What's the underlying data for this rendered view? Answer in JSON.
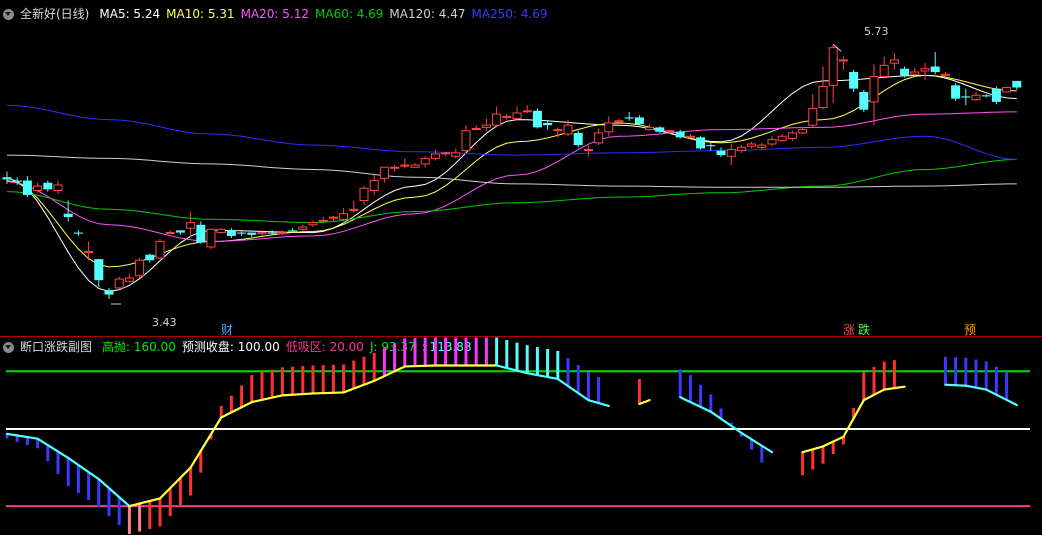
{
  "colors": {
    "up": "#ff4444",
    "down": "#54ffff",
    "ma5": "#ffffff",
    "ma10": "#ffff54",
    "ma20": "#ff54ff",
    "ma60": "#00cc00",
    "ma120": "#d0d0d0",
    "ma250": "#2d2dff",
    "separator": "#aa0000",
    "high_line": "#00dd00",
    "mid_line": "#ffffff",
    "low_line": "#ff3399"
  },
  "main": {
    "title": "全新好(日线)",
    "ma": [
      {
        "label": "MA5: 5.24",
        "color": "#ffffff"
      },
      {
        "label": "MA10: 5.31",
        "color": "#ffff54"
      },
      {
        "label": "MA20: 5.12",
        "color": "#ff54ff"
      },
      {
        "label": "MA60: 4.69",
        "color": "#00cc00"
      },
      {
        "label": "MA120: 4.47",
        "color": "#d0d0d0"
      },
      {
        "label": "MA250: 4.69",
        "color": "#3a3aff"
      }
    ],
    "high_label": "5.73",
    "low_label": "3.43",
    "markers": {
      "cai": "财",
      "zhang": "涨",
      "die": "跌",
      "yu": "预"
    }
  },
  "sub": {
    "title": "断口涨跌副图",
    "items": [
      {
        "label": "高抛: 160.00",
        "color": "#00ee00"
      },
      {
        "label": "预测收盘: 100.00",
        "color": "#ffffff"
      },
      {
        "label": "低吸区: 20.00",
        "color": "#ff3399"
      },
      {
        "label": "J: 93.37",
        "color": "#00ee00"
      },
      {
        "label": ": 113.88",
        "color": "#54ffff"
      }
    ]
  },
  "chart_data": [
    {
      "type": "candlestick",
      "title": "全新好(日线)",
      "ylim": [
        3.15,
        5.95
      ],
      "highest": 5.73,
      "lowest": 3.43,
      "candles": [
        [
          4.53,
          4.51,
          4.58,
          4.47
        ],
        [
          4.5,
          4.49,
          4.53,
          4.46
        ],
        [
          4.5,
          4.37,
          4.54,
          4.35
        ],
        [
          4.41,
          4.45,
          4.48,
          4.39
        ],
        [
          4.48,
          4.42,
          4.5,
          4.4
        ],
        [
          4.41,
          4.46,
          4.5,
          4.38
        ],
        [
          4.2,
          4.17,
          4.32,
          4.13
        ],
        [
          4.03,
          4.02,
          4.05,
          4.0
        ],
        [
          3.85,
          3.86,
          3.95,
          3.78
        ],
        [
          3.79,
          3.6,
          3.79,
          3.54
        ],
        [
          3.51,
          3.47,
          3.53,
          3.43
        ],
        [
          3.53,
          3.61,
          3.63,
          3.52
        ],
        [
          3.59,
          3.62,
          3.66,
          3.58
        ],
        [
          3.64,
          3.78,
          3.8,
          3.62
        ],
        [
          3.83,
          3.78,
          3.84,
          3.76
        ],
        [
          3.8,
          3.95,
          3.97,
          3.79
        ],
        [
          4.03,
          4.03,
          4.05,
          4.02
        ],
        [
          4.05,
          4.03,
          4.05,
          4.01
        ],
        [
          4.07,
          4.12,
          4.22,
          3.99
        ],
        [
          4.1,
          3.94,
          4.13,
          3.93
        ],
        [
          3.9,
          4.06,
          4.06,
          3.88
        ],
        [
          4.03,
          4.06,
          4.07,
          4.02
        ],
        [
          4.05,
          4.0,
          4.07,
          3.98
        ],
        [
          4.03,
          4.02,
          4.04,
          4.0
        ],
        [
          4.03,
          4.01,
          4.03,
          3.99
        ],
        [
          4.02,
          4.03,
          4.05,
          4.0
        ],
        [
          4.03,
          4.02,
          4.05,
          4.01
        ],
        [
          4.02,
          4.03,
          4.05,
          4.01
        ],
        [
          4.05,
          4.04,
          4.07,
          4.03
        ],
        [
          4.06,
          4.08,
          4.1,
          4.04
        ],
        [
          4.1,
          4.12,
          4.14,
          4.08
        ],
        [
          4.14,
          4.14,
          4.17,
          4.12
        ],
        [
          4.16,
          4.17,
          4.18,
          4.13
        ],
        [
          4.15,
          4.2,
          4.25,
          4.13
        ],
        [
          4.24,
          4.24,
          4.32,
          4.21
        ],
        [
          4.32,
          4.43,
          4.45,
          4.28
        ],
        [
          4.41,
          4.5,
          4.55,
          4.37
        ],
        [
          4.52,
          4.62,
          4.62,
          4.48
        ],
        [
          4.62,
          4.62,
          4.64,
          4.58
        ],
        [
          4.63,
          4.64,
          4.7,
          4.61
        ],
        [
          4.62,
          4.64,
          4.66,
          4.62
        ],
        [
          4.65,
          4.7,
          4.72,
          4.62
        ],
        [
          4.7,
          4.74,
          4.78,
          4.68
        ],
        [
          4.75,
          4.75,
          4.76,
          4.72
        ],
        [
          4.72,
          4.75,
          4.79,
          4.7
        ],
        [
          4.77,
          4.95,
          5.0,
          4.76
        ],
        [
          4.97,
          4.97,
          5.0,
          4.95
        ],
        [
          4.98,
          5.0,
          5.06,
          4.95
        ],
        [
          5.0,
          5.1,
          5.17,
          4.98
        ],
        [
          5.07,
          5.08,
          5.1,
          5.05
        ],
        [
          5.06,
          5.11,
          5.17,
          5.04
        ],
        [
          5.13,
          5.13,
          5.18,
          5.11
        ],
        [
          5.13,
          4.98,
          5.15,
          4.97
        ],
        [
          5.02,
          5.0,
          5.04,
          4.96
        ],
        [
          4.96,
          4.96,
          4.98,
          4.89
        ],
        [
          4.92,
          5.0,
          5.05,
          4.9
        ],
        [
          4.93,
          4.82,
          4.95,
          4.8
        ],
        [
          4.78,
          4.78,
          4.82,
          4.72
        ],
        [
          4.84,
          4.93,
          4.97,
          4.82
        ],
        [
          4.94,
          5.02,
          5.08,
          4.9
        ],
        [
          5.03,
          5.04,
          5.06,
          5.01
        ],
        [
          5.07,
          5.06,
          5.12,
          5.04
        ],
        [
          5.07,
          5.01,
          5.09,
          5.0
        ],
        [
          4.96,
          4.98,
          5.01,
          4.95
        ],
        [
          4.98,
          4.94,
          4.99,
          4.93
        ],
        [
          4.95,
          4.95,
          4.96,
          4.92
        ],
        [
          4.94,
          4.89,
          4.96,
          4.88
        ],
        [
          4.89,
          4.9,
          4.92,
          4.88
        ],
        [
          4.89,
          4.79,
          4.9,
          4.78
        ],
        [
          4.82,
          4.81,
          4.84,
          4.77
        ],
        [
          4.77,
          4.73,
          4.8,
          4.71
        ],
        [
          4.72,
          4.78,
          4.83,
          4.64
        ],
        [
          4.77,
          4.8,
          4.82,
          4.75
        ],
        [
          4.81,
          4.83,
          4.85,
          4.79
        ],
        [
          4.8,
          4.82,
          4.84,
          4.78
        ],
        [
          4.83,
          4.87,
          4.9,
          4.81
        ],
        [
          4.86,
          4.9,
          4.92,
          4.85
        ],
        [
          4.88,
          4.93,
          4.95,
          4.86
        ],
        [
          4.93,
          4.96,
          4.98,
          4.92
        ],
        [
          5.0,
          5.15,
          5.28,
          4.98
        ],
        [
          5.16,
          5.35,
          5.53,
          5.14
        ],
        [
          5.36,
          5.7,
          5.73,
          5.2
        ],
        [
          5.58,
          5.59,
          5.62,
          5.5
        ],
        [
          5.48,
          5.33,
          5.5,
          5.3
        ],
        [
          5.3,
          5.14,
          5.32,
          5.12
        ],
        [
          5.21,
          5.44,
          5.55,
          5.0
        ],
        [
          5.44,
          5.54,
          5.62,
          5.42
        ],
        [
          5.56,
          5.59,
          5.65,
          5.5
        ],
        [
          5.51,
          5.45,
          5.53,
          5.43
        ],
        [
          5.46,
          5.48,
          5.52,
          5.44
        ],
        [
          5.49,
          5.51,
          5.56,
          5.41
        ],
        [
          5.53,
          5.48,
          5.66,
          5.46
        ],
        [
          5.45,
          5.46,
          5.48,
          5.43
        ],
        [
          5.36,
          5.24,
          5.38,
          5.22
        ],
        [
          5.26,
          5.25,
          5.33,
          5.18
        ],
        [
          5.23,
          5.27,
          5.3,
          5.22
        ],
        [
          5.27,
          5.26,
          5.28,
          5.25
        ],
        [
          5.33,
          5.21,
          5.35,
          5.19
        ],
        [
          5.3,
          5.34,
          5.35,
          5.3
        ],
        [
          5.4,
          5.34,
          5.4,
          5.32
        ]
      ],
      "series": [
        {
          "name": "MA5",
          "color": "#ffffff",
          "x": [
            0,
            10,
            20,
            30,
            40,
            50,
            60,
            70,
            80,
            90,
            99
          ],
          "y": [
            4.52,
            3.5,
            4.05,
            4.03,
            4.45,
            5.05,
            5.0,
            4.85,
            5.4,
            5.45,
            5.24
          ]
        },
        {
          "name": "MA10",
          "color": "#ffff54",
          "x": [
            0,
            10,
            20,
            30,
            40,
            50,
            60,
            70,
            80,
            90,
            99
          ],
          "y": [
            4.5,
            3.72,
            3.95,
            4.04,
            4.35,
            4.85,
            5.02,
            4.84,
            5.05,
            5.45,
            5.31
          ]
        },
        {
          "name": "MA20",
          "color": "#ff54ff",
          "x": [
            0,
            10,
            20,
            30,
            40,
            50,
            60,
            70,
            80,
            90,
            99
          ],
          "y": [
            4.49,
            4.1,
            3.95,
            4.0,
            4.2,
            4.55,
            4.9,
            4.96,
            4.98,
            5.1,
            5.12
          ]
        },
        {
          "name": "MA60",
          "color": "#00cc00",
          "x": [
            0,
            10,
            20,
            30,
            40,
            50,
            60,
            70,
            80,
            90,
            99
          ],
          "y": [
            4.4,
            4.24,
            4.15,
            4.12,
            4.22,
            4.3,
            4.35,
            4.39,
            4.45,
            4.6,
            4.69
          ]
        },
        {
          "name": "MA120",
          "color": "#d0d0d0",
          "x": [
            0,
            10,
            20,
            30,
            40,
            50,
            60,
            70,
            80,
            90,
            99
          ],
          "y": [
            4.73,
            4.7,
            4.65,
            4.6,
            4.53,
            4.47,
            4.45,
            4.44,
            4.44,
            4.45,
            4.47
          ]
        },
        {
          "name": "MA250",
          "color": "#2d2dff",
          "x": [
            0,
            10,
            20,
            30,
            40,
            50,
            60,
            70,
            80,
            90,
            99
          ],
          "y": [
            5.18,
            5.05,
            4.92,
            4.82,
            4.76,
            4.73,
            4.75,
            4.77,
            4.8,
            4.9,
            4.69
          ]
        }
      ]
    },
    {
      "type": "line",
      "title": "断口涨跌副图",
      "ylim": [
        -10,
        180
      ],
      "reference_lines": [
        {
          "name": "高抛",
          "value": 160,
          "color": "#00dd00"
        },
        {
          "name": "预测收盘",
          "value": 100,
          "color": "#ffffff"
        },
        {
          "name": "低吸区",
          "value": 20,
          "color": "#ff3399"
        }
      ],
      "series": [
        {
          "name": "J",
          "x": [
            0,
            3,
            6,
            9,
            12,
            15,
            18,
            21,
            24,
            27,
            30,
            33,
            36,
            39,
            42,
            45,
            48,
            51,
            54,
            57,
            59,
            60,
            62,
            63,
            64,
            66,
            69,
            72,
            75,
            76,
            77,
            78,
            80,
            82,
            84,
            86,
            88,
            90,
            92,
            94,
            96,
            99
          ],
          "y": [
            95,
            90,
            70,
            48,
            20,
            28,
            60,
            112,
            128,
            135,
            137,
            138,
            150,
            165,
            166,
            166,
            166,
            158,
            152,
            130,
            124,
            null,
            126,
            130,
            null,
            133,
            118,
            96,
            76,
            null,
            null,
            76,
            82,
            92,
            130,
            141,
            144,
            null,
            146,
            145,
            141,
            125
          ]
        }
      ]
    }
  ]
}
